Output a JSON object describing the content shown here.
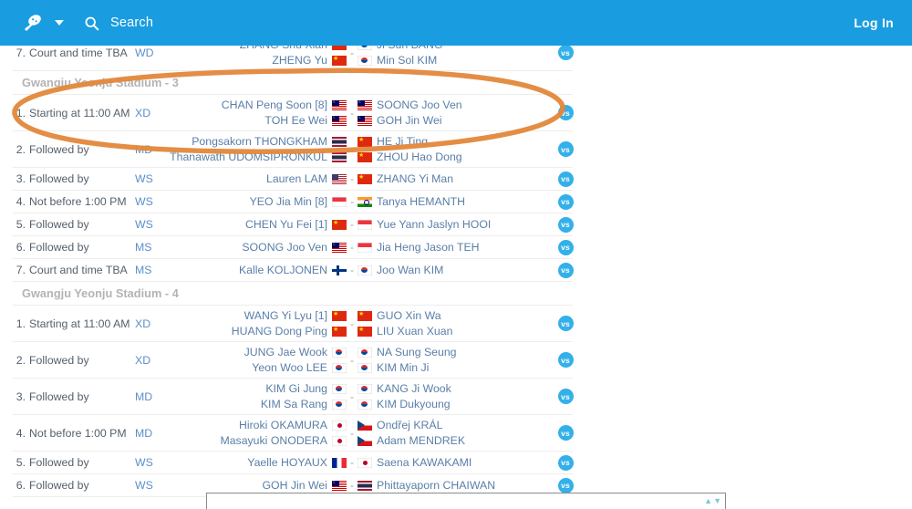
{
  "appbar": {
    "brand_icon": "shuttlecock-logo",
    "caret_icon": "chevron-down-icon",
    "search_icon": "search-icon",
    "search_label": "Search",
    "login_label": "Log In",
    "accent_color": "#199de0"
  },
  "annotation": {
    "type": "hand-drawn-ellipse",
    "color": "#e8893a",
    "encircles": "Gwangju Yeonju Stadium - 3 rows 1 and 2"
  },
  "bottom_panel": {
    "icons": "▲▼"
  },
  "vs_label": "vs",
  "separator": "-",
  "sections": [
    {
      "id": "section-partial-top",
      "header": null,
      "matches": [
        {
          "order": "7.",
          "when": "Court and time TBA",
          "discipline": "WD",
          "home": [
            {
              "name": "ZHANG Shu Xian",
              "flag": "CHN"
            },
            {
              "name": "ZHENG Yu",
              "flag": "CHN"
            }
          ],
          "away": [
            {
              "name": "Ji Sun BANG",
              "flag": "KOR"
            },
            {
              "name": "Min Sol KIM",
              "flag": "KOR"
            }
          ]
        }
      ]
    },
    {
      "id": "section-stadium-3",
      "header": "Gwangju Yeonju Stadium - 3",
      "matches": [
        {
          "order": "1.",
          "when": "Starting at 11:00 AM",
          "discipline": "XD",
          "home": [
            {
              "name": "CHAN Peng Soon [8]",
              "flag": "MAS"
            },
            {
              "name": "TOH Ee Wei",
              "flag": "MAS"
            }
          ],
          "away": [
            {
              "name": "SOONG Joo Ven",
              "flag": "MAS"
            },
            {
              "name": "GOH Jin Wei",
              "flag": "MAS"
            }
          ]
        },
        {
          "order": "2.",
          "when": "Followed by",
          "discipline": "MD",
          "home": [
            {
              "name": "Pongsakorn THONGKHAM",
              "flag": "THA"
            },
            {
              "name": "Thanawath UDOMSIPRONKUL",
              "flag": "THA"
            }
          ],
          "away": [
            {
              "name": "HE Ji Ting",
              "flag": "CHN"
            },
            {
              "name": "ZHOU Hao Dong",
              "flag": "CHN"
            }
          ]
        },
        {
          "order": "3.",
          "when": "Followed by",
          "discipline": "WS",
          "home": [
            {
              "name": "Lauren LAM",
              "flag": "USA"
            }
          ],
          "away": [
            {
              "name": "ZHANG Yi Man",
              "flag": "CHN"
            }
          ]
        },
        {
          "order": "4.",
          "when": "Not before 1:00 PM",
          "discipline": "WS",
          "home": [
            {
              "name": "YEO Jia Min [8]",
              "flag": "SGP"
            }
          ],
          "away": [
            {
              "name": "Tanya HEMANTH",
              "flag": "IND"
            }
          ]
        },
        {
          "order": "5.",
          "when": "Followed by",
          "discipline": "WS",
          "home": [
            {
              "name": "CHEN Yu Fei [1]",
              "flag": "CHN"
            }
          ],
          "away": [
            {
              "name": "Yue Yann Jaslyn HOOI",
              "flag": "SGP"
            }
          ]
        },
        {
          "order": "6.",
          "when": "Followed by",
          "discipline": "MS",
          "home": [
            {
              "name": "SOONG Joo Ven",
              "flag": "MAS"
            }
          ],
          "away": [
            {
              "name": "Jia Heng Jason TEH",
              "flag": "SGP"
            }
          ]
        },
        {
          "order": "7.",
          "when": "Court and time TBA",
          "discipline": "MS",
          "home": [
            {
              "name": "Kalle KOLJONEN",
              "flag": "FIN"
            }
          ],
          "away": [
            {
              "name": "Joo Wan KIM",
              "flag": "KOR"
            }
          ]
        }
      ]
    },
    {
      "id": "section-stadium-4",
      "header": "Gwangju Yeonju Stadium - 4",
      "matches": [
        {
          "order": "1.",
          "when": "Starting at 11:00 AM",
          "discipline": "XD",
          "home": [
            {
              "name": "WANG Yi Lyu [1]",
              "flag": "CHN"
            },
            {
              "name": "HUANG Dong Ping",
              "flag": "CHN"
            }
          ],
          "away": [
            {
              "name": "GUO Xin Wa",
              "flag": "CHN"
            },
            {
              "name": "LIU Xuan Xuan",
              "flag": "CHN"
            }
          ]
        },
        {
          "order": "2.",
          "when": "Followed by",
          "discipline": "XD",
          "home": [
            {
              "name": "JUNG Jae Wook",
              "flag": "KOR"
            },
            {
              "name": "Yeon Woo LEE",
              "flag": "KOR"
            }
          ],
          "away": [
            {
              "name": "NA Sung Seung",
              "flag": "KOR"
            },
            {
              "name": "KIM Min Ji",
              "flag": "KOR"
            }
          ]
        },
        {
          "order": "3.",
          "when": "Followed by",
          "discipline": "MD",
          "home": [
            {
              "name": "KIM Gi Jung",
              "flag": "KOR"
            },
            {
              "name": "KIM Sa Rang",
              "flag": "KOR"
            }
          ],
          "away": [
            {
              "name": "KANG Ji Wook",
              "flag": "KOR"
            },
            {
              "name": "KIM Dukyoung",
              "flag": "KOR"
            }
          ]
        },
        {
          "order": "4.",
          "when": "Not before 1:00 PM",
          "discipline": "MD",
          "home": [
            {
              "name": "Hiroki OKAMURA",
              "flag": "JPN"
            },
            {
              "name": "Masayuki ONODERA",
              "flag": "JPN"
            }
          ],
          "away": [
            {
              "name": "Ondřej KRÁL",
              "flag": "CZE"
            },
            {
              "name": "Adam MENDREK",
              "flag": "CZE"
            }
          ]
        },
        {
          "order": "5.",
          "when": "Followed by",
          "discipline": "WS",
          "home": [
            {
              "name": "Yaelle HOYAUX",
              "flag": "FRA"
            }
          ],
          "away": [
            {
              "name": "Saena KAWAKAMI",
              "flag": "JPN"
            }
          ]
        },
        {
          "order": "6.",
          "when": "Followed by",
          "discipline": "WS",
          "home": [
            {
              "name": "GOH Jin Wei",
              "flag": "MAS"
            }
          ],
          "away": [
            {
              "name": "Phittayaporn CHAIWAN",
              "flag": "THA"
            }
          ]
        }
      ]
    }
  ]
}
